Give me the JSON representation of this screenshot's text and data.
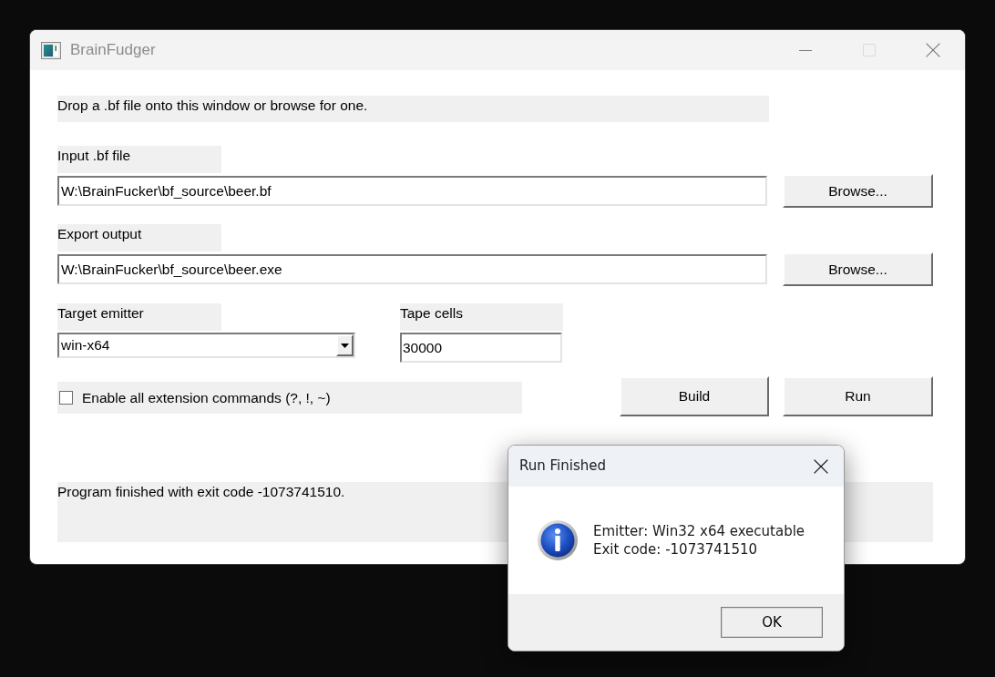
{
  "window": {
    "title": "BrainFudger",
    "active": false,
    "controls": [
      {
        "kind": "minimize",
        "disabled": false
      },
      {
        "kind": "maximize",
        "disabled": true
      },
      {
        "kind": "close",
        "disabled": false
      }
    ]
  },
  "hint": "Drop a .bf file onto this window or browse for one.",
  "input_file": {
    "label": "Input .bf file",
    "value": "W:\\BrainFucker\\bf_source\\beer.bf",
    "button": "Browse..."
  },
  "export_output": {
    "label": "Export output",
    "value": "W:\\BrainFucker\\bf_source\\beer.exe",
    "button": "Browse..."
  },
  "target_emitter": {
    "label": "Target emitter",
    "value": "win-x64"
  },
  "tape_cells": {
    "label": "Tape cells",
    "value": "30000"
  },
  "extensions_checkbox": {
    "label": "Enable all extension commands (?, !, ~)",
    "checked": false
  },
  "actions": [
    "Build",
    "Run"
  ],
  "status": "Program finished with exit code -1073741510.",
  "dialog": {
    "title": "Run Finished",
    "active": true,
    "kind": "info",
    "lines": [
      "Emitter: Win32 x64 executable",
      "Exit code: -1073741510"
    ],
    "button": "OK"
  }
}
